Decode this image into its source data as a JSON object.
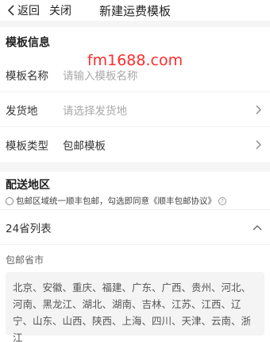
{
  "nav": {
    "back_label": "返回",
    "close_label": "关闭",
    "title": "新建运费模板"
  },
  "template_info": {
    "section_title": "模板信息",
    "name_label": "模板名称",
    "name_placeholder": "请输入模板名称",
    "ship_from_label": "发货地",
    "ship_from_placeholder": "请选择发货地",
    "type_label": "模板类型",
    "type_value": "包邮模板"
  },
  "watermark": "fm1688.com",
  "delivery": {
    "section_title": "配送地区",
    "agree_text": "包邮区域统一顺丰包邮，勾选即同意《顺丰包邮协议》",
    "provinces_header": "24省列表",
    "free_label": "包邮省市",
    "provinces_text": "北京、安徽、重庆、福建、广东、广西、贵州、河北、河南、黑龙江、湖北、湖南、吉林、江苏、江西、辽宁、山东、山西、陕西、上海、四川、天津、云南、浙江"
  }
}
